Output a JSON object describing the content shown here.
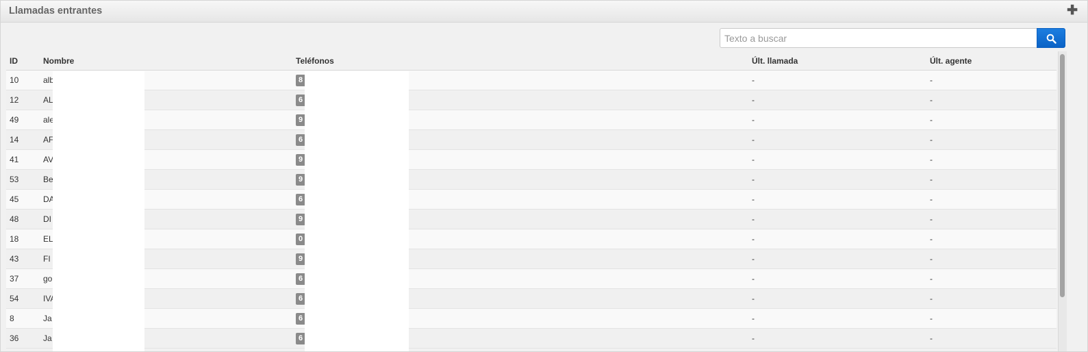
{
  "panel": {
    "title": "Llamadas entrantes",
    "add_icon": "plus-icon"
  },
  "search": {
    "placeholder": "Texto a buscar",
    "value": "",
    "button_icon": "search-icon"
  },
  "table": {
    "columns": {
      "id": "ID",
      "name": "Nombre",
      "phones": "Teléfonos",
      "last_call": "Últ. llamada",
      "last_agent": "Últ. agente"
    },
    "rows": [
      {
        "id": "10",
        "name": "alb",
        "phone": "8",
        "last_call": "-",
        "last_agent": "-"
      },
      {
        "id": "12",
        "name": "AL",
        "phone": "6",
        "last_call": "-",
        "last_agent": "-"
      },
      {
        "id": "49",
        "name": "ale",
        "phone": "9",
        "last_call": "-",
        "last_agent": "-"
      },
      {
        "id": "14",
        "name": "AF",
        "phone": "6",
        "last_call": "-",
        "last_agent": "-"
      },
      {
        "id": "41",
        "name": "AV",
        "phone": "9",
        "last_call": "-",
        "last_agent": "-"
      },
      {
        "id": "53",
        "name": "Be",
        "phone": "9",
        "last_call": "-",
        "last_agent": "-"
      },
      {
        "id": "45",
        "name": "DA",
        "phone": "6",
        "last_call": "-",
        "last_agent": "-"
      },
      {
        "id": "48",
        "name": "DI",
        "phone": "9",
        "last_call": "-",
        "last_agent": "-"
      },
      {
        "id": "18",
        "name": "EL",
        "phone": "0",
        "last_call": "-",
        "last_agent": "-"
      },
      {
        "id": "43",
        "name": "FI",
        "phone": "9",
        "last_call": "-",
        "last_agent": "-"
      },
      {
        "id": "37",
        "name": "go",
        "phone": "6",
        "last_call": "-",
        "last_agent": "-"
      },
      {
        "id": "54",
        "name": "IVA",
        "phone": "6",
        "last_call": "-",
        "last_agent": "-"
      },
      {
        "id": "8",
        "name": "Ja",
        "phone": "6",
        "last_call": "-",
        "last_agent": "-"
      },
      {
        "id": "36",
        "name": "Ja",
        "phone": "6",
        "last_call": "-",
        "last_agent": "-"
      }
    ]
  }
}
